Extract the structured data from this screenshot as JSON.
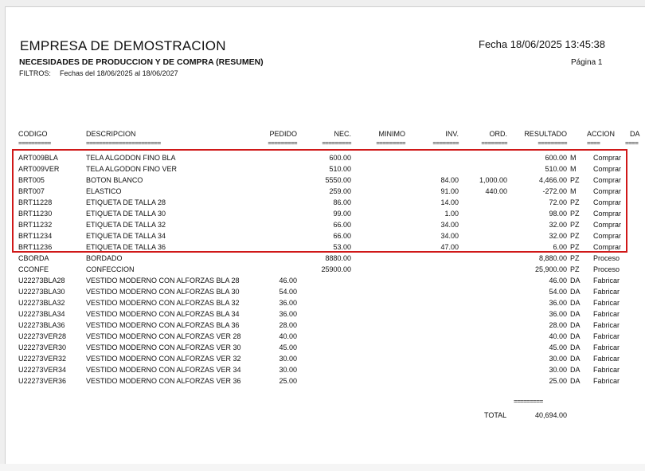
{
  "header": {
    "company": "EMPRESA DE DEMOSTRACION",
    "fecha": "Fecha 18/06/2025 13:45:38",
    "title": "NECESIDADES DE PRODUCCION Y DE COMPRA (RESUMEN)",
    "page": "Página 1",
    "filters_label": "FILTROS:",
    "filters_value": "Fechas del 18/06/2025 al 18/06/2027"
  },
  "columns": {
    "codigo": "CODIGO",
    "descripcion": "DESCRIPCION",
    "pedido": "PEDIDO",
    "nec": "NEC.",
    "minimo": "MINIMO",
    "inv": "INV.",
    "ord": "ORD.",
    "resultado": "RESULTADO",
    "accion": "ACCION",
    "extra": "DA"
  },
  "underlines": {
    "codigo": "==========",
    "descripcion": "=======================",
    "pedido": "=========",
    "nec": "=========",
    "minimo": "=========",
    "inv": "========",
    "ord": "========",
    "resultado": "=========",
    "accion": "====",
    "extra": "===="
  },
  "rows": [
    {
      "code": "ART009BLA",
      "desc": "TELA ALGODON FINO BLA",
      "pedido": "",
      "nec": "600.00",
      "inv": "",
      "ord": "",
      "res": "600.00",
      "unit": "M",
      "accion": "Comprar"
    },
    {
      "code": "ART009VER",
      "desc": "TELA ALGODON FINO VER",
      "pedido": "",
      "nec": "510.00",
      "inv": "",
      "ord": "",
      "res": "510.00",
      "unit": "M",
      "accion": "Comprar"
    },
    {
      "code": "BRT005",
      "desc": "BOTON BLANCO",
      "pedido": "",
      "nec": "5550.00",
      "inv": "84.00",
      "ord": "1,000.00",
      "res": "4,466.00",
      "unit": "PZ",
      "accion": "Comprar"
    },
    {
      "code": "BRT007",
      "desc": "ELASTICO",
      "pedido": "",
      "nec": "259.00",
      "inv": "91.00",
      "ord": "440.00",
      "res": "-272.00",
      "unit": "M",
      "accion": "Comprar"
    },
    {
      "code": "BRT11228",
      "desc": "ETIQUETA DE TALLA 28",
      "pedido": "",
      "nec": "86.00",
      "inv": "14.00",
      "ord": "",
      "res": "72.00",
      "unit": "PZ",
      "accion": "Comprar"
    },
    {
      "code": "BRT11230",
      "desc": "ETIQUETA DE TALLA 30",
      "pedido": "",
      "nec": "99.00",
      "inv": "1.00",
      "ord": "",
      "res": "98.00",
      "unit": "PZ",
      "accion": "Comprar"
    },
    {
      "code": "BRT11232",
      "desc": "ETIQUETA DE TALLA 32",
      "pedido": "",
      "nec": "66.00",
      "inv": "34.00",
      "ord": "",
      "res": "32.00",
      "unit": "PZ",
      "accion": "Comprar"
    },
    {
      "code": "BRT11234",
      "desc": "ETIQUETA DE TALLA 34",
      "pedido": "",
      "nec": "66.00",
      "inv": "34.00",
      "ord": "",
      "res": "32.00",
      "unit": "PZ",
      "accion": "Comprar"
    },
    {
      "code": "BRT11236",
      "desc": "ETIQUETA DE TALLA 36",
      "pedido": "",
      "nec": "53.00",
      "inv": "47.00",
      "ord": "",
      "res": "6.00",
      "unit": "PZ",
      "accion": "Comprar"
    },
    {
      "code": "CBORDA",
      "desc": "BORDADO",
      "pedido": "",
      "nec": "8880.00",
      "inv": "",
      "ord": "",
      "res": "8,880.00",
      "unit": "PZ",
      "accion": "Proceso"
    },
    {
      "code": "CCONFE",
      "desc": "CONFECCION",
      "pedido": "",
      "nec": "25900.00",
      "inv": "",
      "ord": "",
      "res": "25,900.00",
      "unit": "PZ",
      "accion": "Proceso"
    },
    {
      "code": "U22273BLA28",
      "desc": "VESTIDO MODERNO CON ALFORZAS BLA 28",
      "pedido": "46.00",
      "nec": "",
      "inv": "",
      "ord": "",
      "res": "46.00",
      "unit": "DA",
      "accion": "Fabricar"
    },
    {
      "code": "U22273BLA30",
      "desc": "VESTIDO MODERNO CON ALFORZAS BLA 30",
      "pedido": "54.00",
      "nec": "",
      "inv": "",
      "ord": "",
      "res": "54.00",
      "unit": "DA",
      "accion": "Fabricar"
    },
    {
      "code": "U22273BLA32",
      "desc": "VESTIDO MODERNO CON ALFORZAS BLA 32",
      "pedido": "36.00",
      "nec": "",
      "inv": "",
      "ord": "",
      "res": "36.00",
      "unit": "DA",
      "accion": "Fabricar"
    },
    {
      "code": "U22273BLA34",
      "desc": "VESTIDO MODERNO CON ALFORZAS BLA 34",
      "pedido": "36.00",
      "nec": "",
      "inv": "",
      "ord": "",
      "res": "36.00",
      "unit": "DA",
      "accion": "Fabricar"
    },
    {
      "code": "U22273BLA36",
      "desc": "VESTIDO MODERNO CON ALFORZAS BLA 36",
      "pedido": "28.00",
      "nec": "",
      "inv": "",
      "ord": "",
      "res": "28.00",
      "unit": "DA",
      "accion": "Fabricar"
    },
    {
      "code": "U22273VER28",
      "desc": "VESTIDO MODERNO CON ALFORZAS VER 28",
      "pedido": "40.00",
      "nec": "",
      "inv": "",
      "ord": "",
      "res": "40.00",
      "unit": "DA",
      "accion": "Fabricar"
    },
    {
      "code": "U22273VER30",
      "desc": "VESTIDO MODERNO CON ALFORZAS VER 30",
      "pedido": "45.00",
      "nec": "",
      "inv": "",
      "ord": "",
      "res": "45.00",
      "unit": "DA",
      "accion": "Fabricar"
    },
    {
      "code": "U22273VER32",
      "desc": "VESTIDO MODERNO CON ALFORZAS VER 32",
      "pedido": "30.00",
      "nec": "",
      "inv": "",
      "ord": "",
      "res": "30.00",
      "unit": "DA",
      "accion": "Fabricar"
    },
    {
      "code": "U22273VER34",
      "desc": "VESTIDO MODERNO CON ALFORZAS VER 34",
      "pedido": "30.00",
      "nec": "",
      "inv": "",
      "ord": "",
      "res": "30.00",
      "unit": "DA",
      "accion": "Fabricar"
    },
    {
      "code": "U22273VER36",
      "desc": "VESTIDO MODERNO CON ALFORZAS VER 36",
      "pedido": "25.00",
      "nec": "",
      "inv": "",
      "ord": "",
      "res": "25.00",
      "unit": "DA",
      "accion": "Fabricar"
    }
  ],
  "total": {
    "line": "=========",
    "label": "TOTAL",
    "value": "40,694.00"
  },
  "colors": {
    "highlight": "#d01818"
  }
}
